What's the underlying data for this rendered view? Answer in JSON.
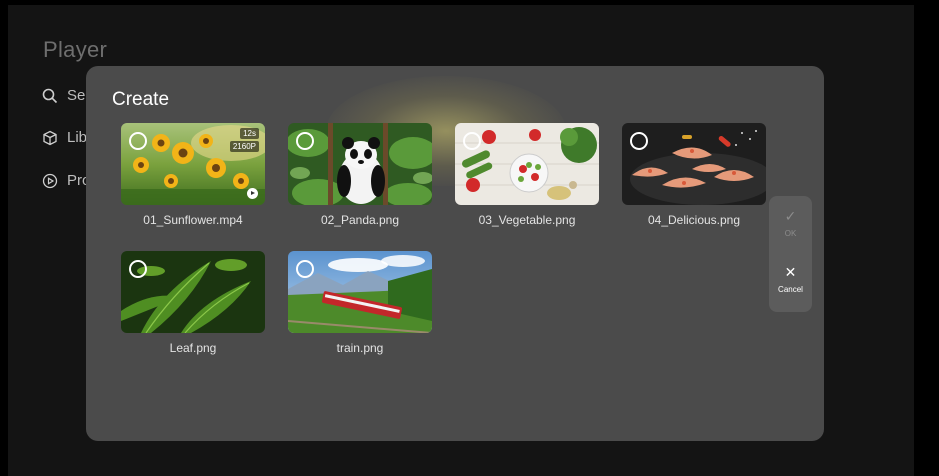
{
  "app": {
    "title": "Player",
    "sidebar": [
      {
        "label": "Sea",
        "icon": "search-icon"
      },
      {
        "label": "Lib",
        "icon": "cube-icon"
      },
      {
        "label": "Pro",
        "icon": "play-circle-icon"
      }
    ]
  },
  "dialog": {
    "title": "Create",
    "items": [
      {
        "name": "01_Sunflower.mp4",
        "type": "video",
        "duration": "12s",
        "resolution": "2160P",
        "selected": false
      },
      {
        "name": "02_Panda.png",
        "type": "image",
        "selected": false
      },
      {
        "name": "03_Vegetable.png",
        "type": "image",
        "selected": false
      },
      {
        "name": "04_Delicious.png",
        "type": "image",
        "selected": false
      },
      {
        "name": "Leaf.png",
        "type": "image",
        "selected": false
      },
      {
        "name": "train.png",
        "type": "image",
        "selected": false
      }
    ],
    "actions": {
      "ok": {
        "label": "OK",
        "icon": "check-icon",
        "enabled": false
      },
      "cancel": {
        "label": "Cancel",
        "icon": "close-icon",
        "enabled": true
      }
    }
  },
  "colors": {
    "dialog_bg": "#4b4b4b",
    "page_bg": "#141414",
    "action_panel_bg": "#5c5c5c",
    "disabled_text": "#8c8c8c"
  }
}
